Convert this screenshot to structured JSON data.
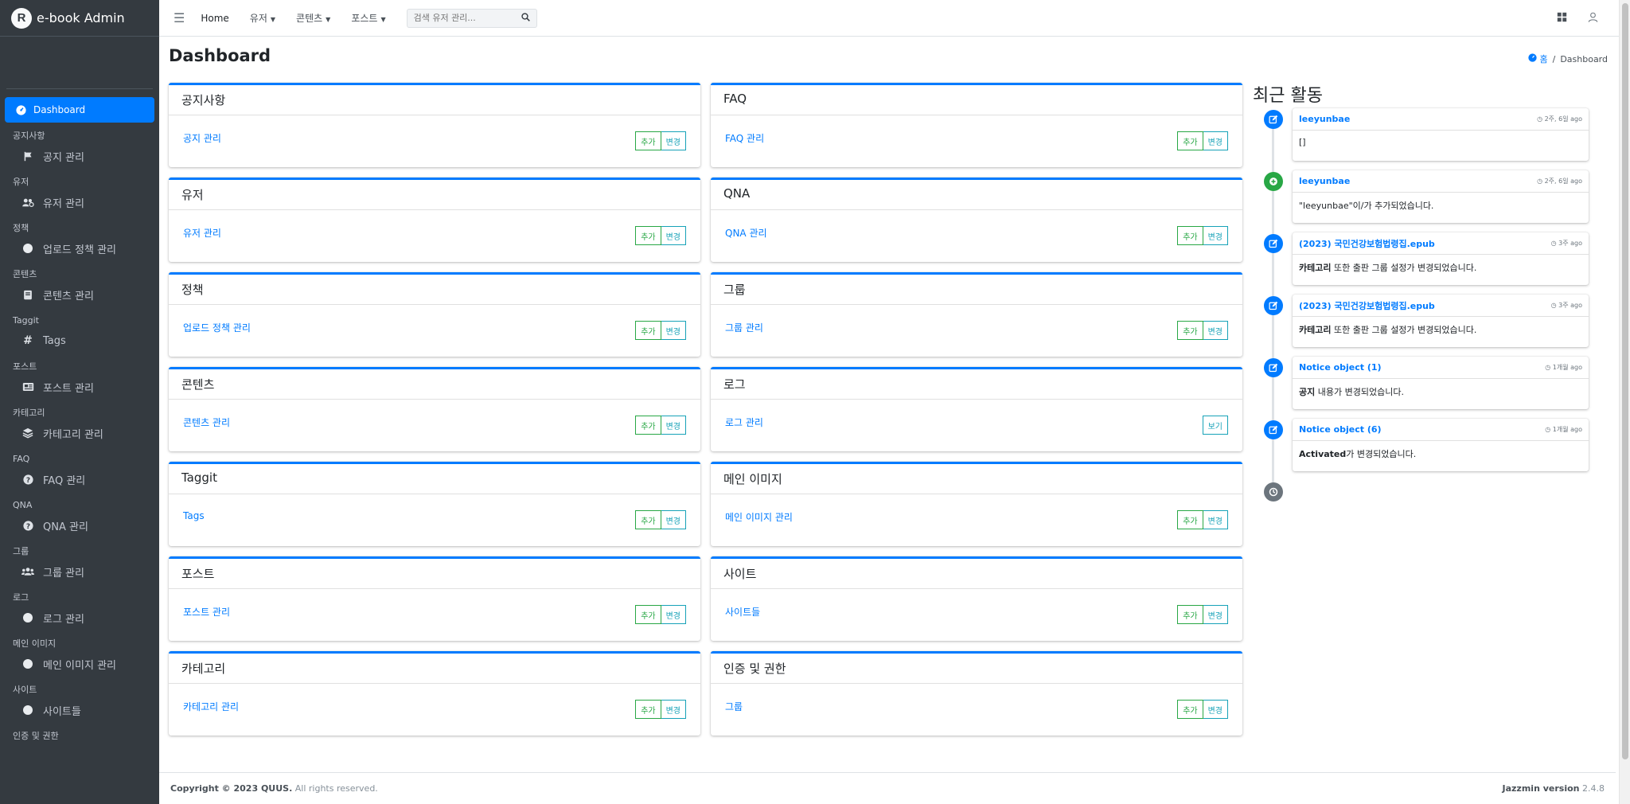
{
  "brand": {
    "logo_letter": "R",
    "title": "e-book Admin"
  },
  "sidebar": {
    "active": {
      "label": "Dashboard",
      "icon": "tachometer-icon"
    },
    "groups": [
      {
        "header": "공지사항",
        "item": "공지 관리",
        "icon": "flag-icon"
      },
      {
        "header": "유저",
        "item": "유저 관리",
        "icon": "users-cog-icon"
      },
      {
        "header": "정책",
        "item": "업로드 정책 관리",
        "icon": "circle-icon"
      },
      {
        "header": "콘텐츠",
        "item": "콘텐츠 관리",
        "icon": "book-icon"
      },
      {
        "header": "Taggit",
        "item": "Tags",
        "icon": "hashtag-icon"
      },
      {
        "header": "포스트",
        "item": "포스트 관리",
        "icon": "newspaper-icon"
      },
      {
        "header": "카테고리",
        "item": "카테고리 관리",
        "icon": "layer-group-icon"
      },
      {
        "header": "FAQ",
        "item": "FAQ 관리",
        "icon": "question-circle-icon"
      },
      {
        "header": "QNA",
        "item": "QNA 관리",
        "icon": "question-circle-icon"
      },
      {
        "header": "그룹",
        "item": "그룹 관리",
        "icon": "users-icon"
      },
      {
        "header": "로그",
        "item": "로그 관리",
        "icon": "circle-icon"
      },
      {
        "header": "메인 이미지",
        "item": "메인 이미지 관리",
        "icon": "circle-icon"
      },
      {
        "header": "사이트",
        "item": "사이트들",
        "icon": "circle-icon"
      },
      {
        "header": "인증 및 권한",
        "item": "",
        "icon": ""
      }
    ]
  },
  "topbar": {
    "home": "Home",
    "menus": [
      "유저",
      "콘텐츠",
      "포스트"
    ],
    "search_placeholder": "검색 유저 관리..."
  },
  "page": {
    "title": "Dashboard"
  },
  "breadcrumb": {
    "home": "홈",
    "separator": "/",
    "current": "Dashboard"
  },
  "buttons": {
    "add": "추가",
    "change": "변경",
    "view": "보기"
  },
  "cards": {
    "left": [
      {
        "title": "공지사항",
        "link": "공지 관리"
      },
      {
        "title": "유저",
        "link": "유저 관리"
      },
      {
        "title": "정책",
        "link": "업로드 정책 관리"
      },
      {
        "title": "콘텐츠",
        "link": "콘텐츠 관리"
      },
      {
        "title": "Taggit",
        "link": "Tags"
      },
      {
        "title": "포스트",
        "link": "포스트 관리"
      },
      {
        "title": "카테고리",
        "link": "카테고리 관리"
      }
    ],
    "right": [
      {
        "title": "FAQ",
        "link": "FAQ 관리"
      },
      {
        "title": "QNA",
        "link": "QNA 관리"
      },
      {
        "title": "그룹",
        "link": "그룹 관리"
      },
      {
        "title": "로그",
        "link": "로그 관리"
      },
      {
        "title": "메인 이미지",
        "link": "메인 이미지 관리"
      },
      {
        "title": "사이트",
        "link": "사이트들"
      },
      {
        "title": "인증 및 권한",
        "link": "그룹"
      }
    ]
  },
  "timeline": {
    "title": "최근 활동",
    "items": [
      {
        "user": "leeyunbae",
        "time": "2주, 6일 ago",
        "body_bold": "",
        "body": "[]",
        "icon": "edit-icon",
        "color": "#007bff"
      },
      {
        "user": "leeyunbae",
        "time": "2주, 6일 ago",
        "body_bold": "",
        "body": "\"leeyunbae\"이/가 추가되었습니다.",
        "icon": "plus-circle-icon",
        "color": "#28a745"
      },
      {
        "user": "(2023) 국민건강보험법령집.epub",
        "time": "3주 ago",
        "body_bold": "카테고리",
        "body": " 또한 출판 그룹 설정가 변경되었습니다.",
        "icon": "edit-icon",
        "color": "#007bff"
      },
      {
        "user": "(2023) 국민건강보험법령집.epub",
        "time": "3주 ago",
        "body_bold": "카테고리",
        "body": " 또한 출판 그룹 설정가 변경되었습니다.",
        "icon": "edit-icon",
        "color": "#007bff"
      },
      {
        "user": "Notice object (1)",
        "time": "1개월 ago",
        "body_bold": "공지",
        "body": " 내용가 변경되었습니다.",
        "icon": "edit-icon",
        "color": "#007bff"
      },
      {
        "user": "Notice object (6)",
        "time": "1개월 ago",
        "body_bold": "Activated",
        "body": "가 변경되었습니다.",
        "icon": "edit-icon",
        "color": "#007bff"
      }
    ]
  },
  "footer": {
    "copyright_prefix": "Copyright © 2023 ",
    "company": "QUUS.",
    "copyright_suffix": " All rights reserved.",
    "version_label": "Jazzmin version",
    "version": " 2.4.8"
  }
}
